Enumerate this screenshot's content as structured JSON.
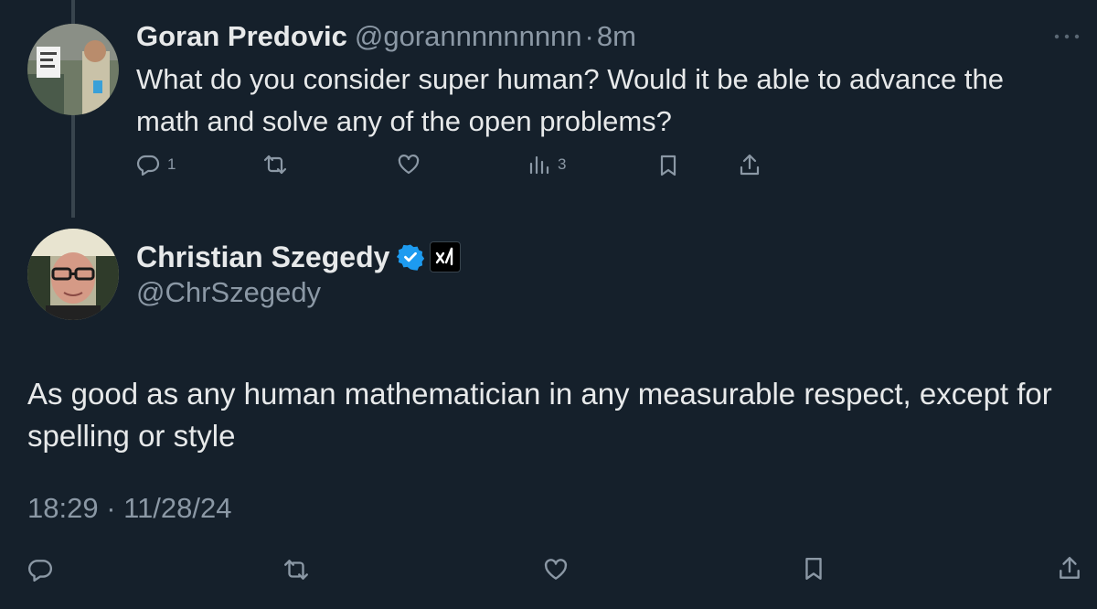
{
  "parent_tweet": {
    "author_name": "Goran Predovic",
    "handle": "@gorannnnnnnnn",
    "separator": "·",
    "time": "8m",
    "text": "What do you consider super human? Would it be able to advance the math and solve any of the open problems?",
    "more_icon": "more-options-icon",
    "actions": {
      "reply_count": "1",
      "retweet_count": "",
      "like_count": "",
      "views_count": "3"
    }
  },
  "main_tweet": {
    "author_name": "Christian Szegedy",
    "handle": "@ChrSzegedy",
    "verified_icon": "verified-badge-icon",
    "affiliate_icon": "xai-affiliate-icon",
    "affiliate_glyph": "x/",
    "text": "As good as any human mathematician in any measurable respect, except for spelling or style",
    "timestamp": "18:29 · 11/28/24"
  },
  "colors": {
    "background": "#15202b",
    "primary_text": "#e7e9ea",
    "secondary_text": "#8b98a5",
    "verified_blue": "#1d9bf0",
    "thread_line": "#38444d"
  }
}
